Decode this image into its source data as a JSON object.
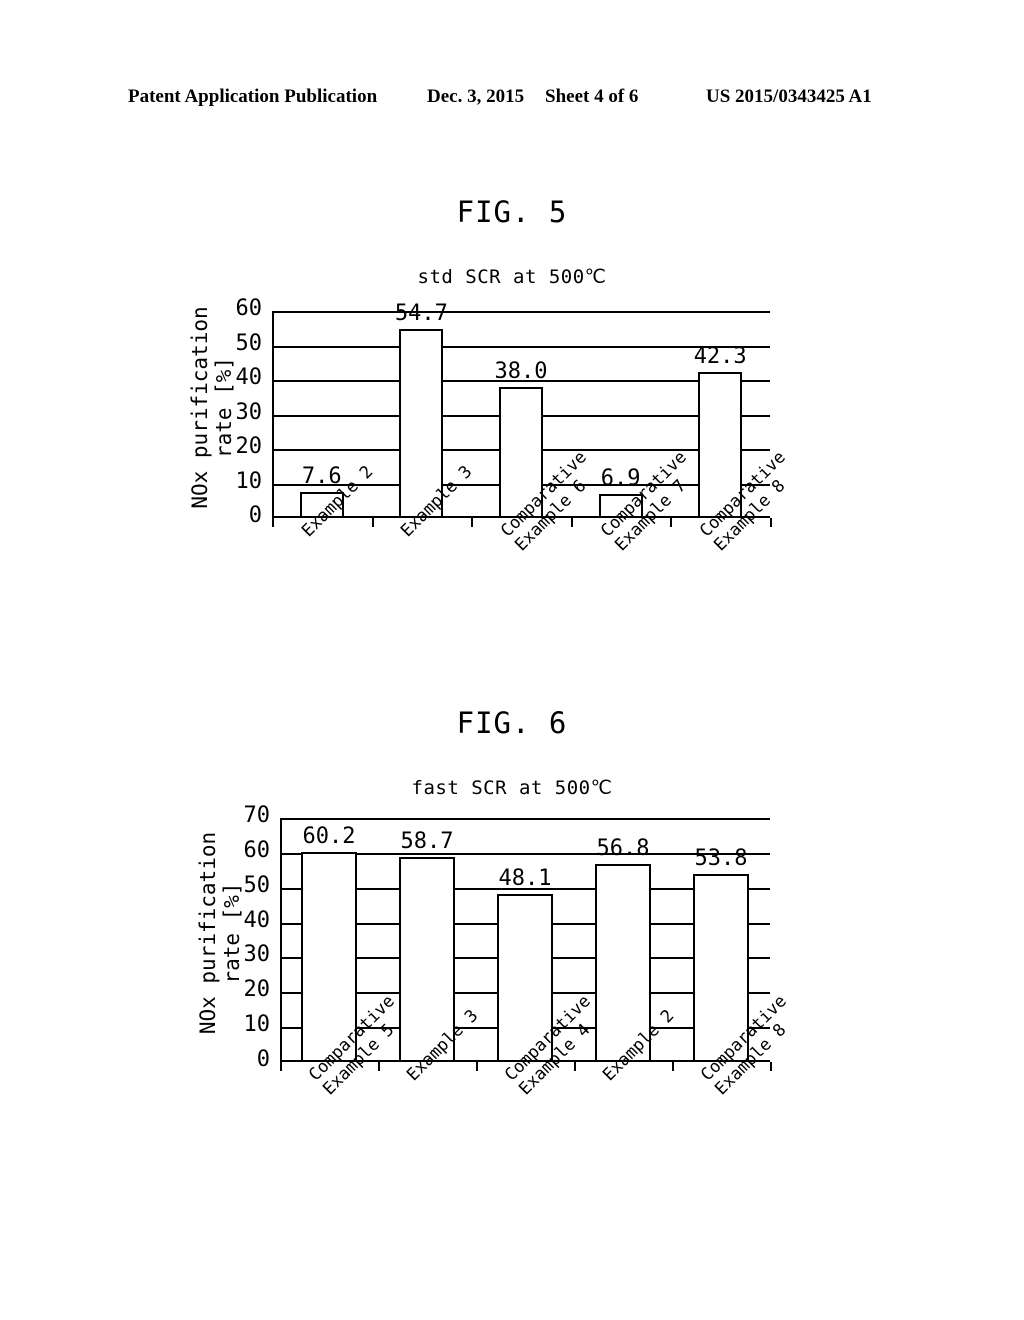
{
  "page_header": {
    "publication": "Patent Application Publication",
    "date": "Dec. 3, 2015",
    "sheet": "Sheet 4 of 6",
    "patent_number": "US 2015/0343425 A1"
  },
  "figures": [
    {
      "caption": "FIG. 5",
      "ylabel_line1": "NOx purification",
      "ylabel_line2": "rate [%]"
    },
    {
      "caption": "FIG. 6",
      "ylabel_line1": "NOx purification",
      "ylabel_line2": "rate [%]"
    }
  ],
  "chart_data": [
    {
      "type": "bar",
      "title": "std SCR at 500℃",
      "xlabel": "",
      "ylabel": "NOx purification rate [%]",
      "categories": [
        "Example 2",
        "Example 3",
        "Comparative Example 6",
        "Comparative Example 7",
        "Comparative Example 8"
      ],
      "category_lines": [
        [
          "Example 2"
        ],
        [
          "Example 3"
        ],
        [
          "Comparative",
          "Example 6"
        ],
        [
          "Comparative",
          "Example 7"
        ],
        [
          "Comparative",
          "Example 8"
        ]
      ],
      "values": [
        7.6,
        54.7,
        38.0,
        6.9,
        42.3
      ],
      "value_labels": [
        "7.6",
        "54.7",
        "38.0",
        "6.9",
        "42.3"
      ],
      "ylim": [
        0,
        60
      ],
      "yticks": [
        0,
        10,
        20,
        30,
        40,
        50,
        60
      ],
      "ytick_labels": [
        "0",
        "10",
        "20",
        "30",
        "40",
        "50",
        "60"
      ],
      "grid": true,
      "legend": false
    },
    {
      "type": "bar",
      "title": "fast SCR at 500℃",
      "xlabel": "",
      "ylabel": "NOx purification rate [%]",
      "categories": [
        "Comparative Example 5",
        "Example 3",
        "Comparative Example 4",
        "Example 2",
        "Comparative Example 8"
      ],
      "category_lines": [
        [
          "Comparative",
          "Example 5"
        ],
        [
          "Example 3"
        ],
        [
          "Comparative",
          "Example 4"
        ],
        [
          "Example 2"
        ],
        [
          "Comparative",
          "Example 8"
        ]
      ],
      "values": [
        60.2,
        58.7,
        48.1,
        56.8,
        53.8
      ],
      "value_labels": [
        "60.2",
        "58.7",
        "48.1",
        "56.8",
        "53.8"
      ],
      "ylim": [
        0,
        70
      ],
      "yticks": [
        0,
        10,
        20,
        30,
        40,
        50,
        60,
        70
      ],
      "ytick_labels": [
        "0",
        "10",
        "20",
        "30",
        "40",
        "50",
        "60",
        "70"
      ],
      "grid": true,
      "legend": false
    }
  ]
}
